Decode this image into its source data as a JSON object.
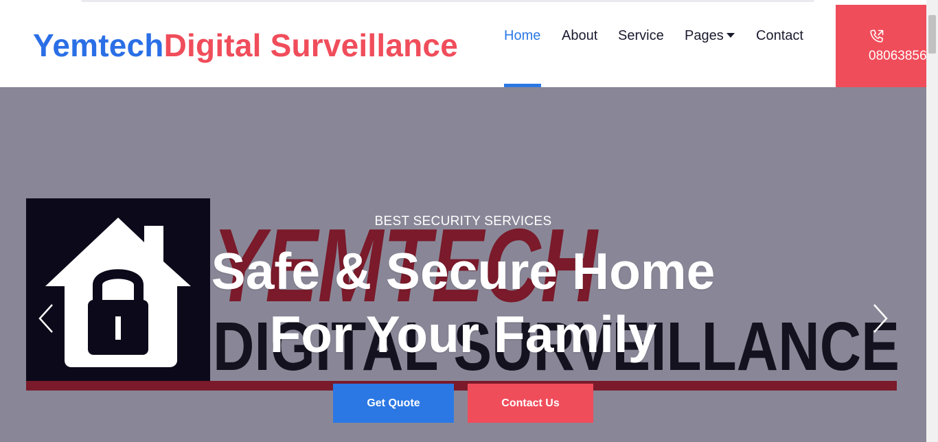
{
  "header": {
    "brand_part1": "Yemtech",
    "brand_part2": "Digital Surveillance",
    "nav": {
      "home": "Home",
      "about": "About",
      "service": "Service",
      "pages": "Pages",
      "contact": "Contact"
    },
    "phone_number": "08063856"
  },
  "hero": {
    "kicker": "BEST SECURITY SERVICES",
    "title_line1": "Safe & Secure Home",
    "title_line2": "For Your Family",
    "button_quote": "Get Quote",
    "button_contact": "Contact Us",
    "background_logo_text_top": "YEMTECH",
    "background_logo_text_bottom": "DIGITAL SURVEILLANCE"
  },
  "colors": {
    "accent_blue": "#2b78e4",
    "accent_red": "#f04d5b",
    "hero_bg": "#898797",
    "logo_dark": "#0c0a1a"
  },
  "icons": {
    "phone": "phone-call-icon",
    "prev": "chevron-left-icon",
    "next": "chevron-right-icon",
    "dropdown": "caret-down-icon",
    "logo": "house-lock-icon"
  }
}
